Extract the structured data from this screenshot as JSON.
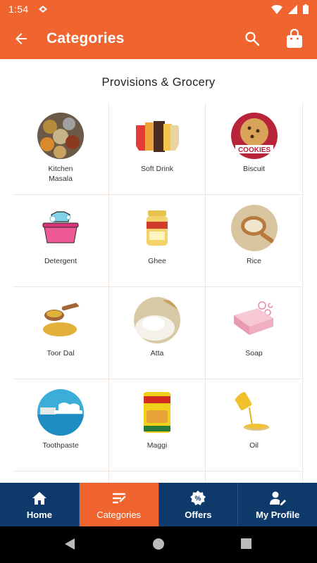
{
  "status_bar": {
    "time": "1:54"
  },
  "app_bar": {
    "title": "Categories"
  },
  "section": {
    "title": "Provisions & Grocery"
  },
  "categories": [
    {
      "label": "Kitchen\nMasala",
      "icon": "kitchen-masala-image"
    },
    {
      "label": "Soft Drink",
      "icon": "soft-drink-image"
    },
    {
      "label": "Biscuit",
      "icon": "biscuit-image"
    },
    {
      "label": "Detergent",
      "icon": "detergent-image"
    },
    {
      "label": "Ghee",
      "icon": "ghee-image"
    },
    {
      "label": "Rice",
      "icon": "rice-image"
    },
    {
      "label": "Toor Dal",
      "icon": "toor-dal-image"
    },
    {
      "label": "Atta",
      "icon": "atta-image"
    },
    {
      "label": "Soap",
      "icon": "soap-image"
    },
    {
      "label": "Toothpaste",
      "icon": "toothpaste-image"
    },
    {
      "label": "Maggi",
      "icon": "maggi-image"
    },
    {
      "label": "Oil",
      "icon": "oil-image"
    }
  ],
  "bottom_nav": [
    {
      "label": "Home",
      "icon": "home-icon",
      "active": false
    },
    {
      "label": "Categories",
      "icon": "categories-icon",
      "active": true
    },
    {
      "label": "Offers",
      "icon": "offers-icon",
      "active": false
    },
    {
      "label": "My Profile",
      "icon": "profile-icon",
      "active": false
    }
  ],
  "colors": {
    "primary": "#f0642f",
    "nav": "#0d3a6b"
  }
}
